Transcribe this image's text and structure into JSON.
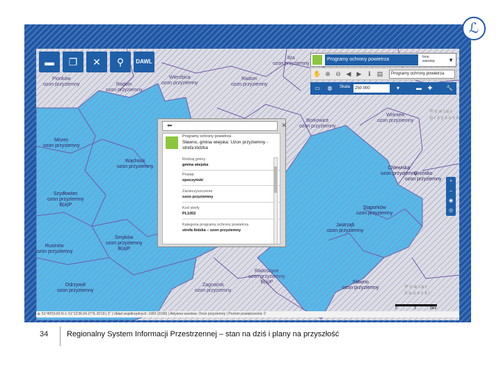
{
  "slide": {
    "number": "34",
    "footer_title": "Regionalny System Informacji Przestrzennej – stan na dziś i plany na przyszłość",
    "logo_glyph": "ℒ"
  },
  "colors": {
    "frame": "#1f57a6",
    "map_blue": "#55b9e9",
    "map_gray": "#dcdde4",
    "boundary": "#6f5aa8",
    "accent_green": "#8cc63e"
  },
  "toolbar": {
    "buttons": [
      {
        "name": "folder-icon",
        "glyph": "▬"
      },
      {
        "name": "windows-icon",
        "glyph": "❐"
      },
      {
        "name": "tools-icon",
        "glyph": "✕"
      },
      {
        "name": "search-icon",
        "glyph": "⚲"
      },
      {
        "name": "dawl-button",
        "glyph": "DAWL"
      }
    ]
  },
  "layer_select": {
    "value": "Programy ochrony powietrza",
    "sub": "Inne\nwarstwy",
    "arrow": "▼"
  },
  "toolbar2": {
    "select_value": "Programy ochrony powietrza"
  },
  "toolbar3": {
    "scale_label": "Skala",
    "scale_value": "250 000"
  },
  "side_ctrl": [
    "+",
    "–",
    "◉",
    "◎"
  ],
  "powiats": [
    {
      "text": "Powiat\nprzysucki"
    },
    {
      "text": "Powiat\nkonecki"
    }
  ],
  "regions": [
    {
      "text": "Pionków\nozon przyziemny"
    },
    {
      "text": "Radom\nozon przyziemny"
    },
    {
      "text": "Wierzbica\nozon przyziemny"
    },
    {
      "text": "Radom\nozon przyziemny"
    },
    {
      "text": "Iłża\nozon przyziemny"
    },
    {
      "text": "Wolanów\nozon przyziemny"
    },
    {
      "text": "Kowala\nozon przyziemny"
    },
    {
      "text": "Mirzec\nozon przyziemny"
    },
    {
      "text": "Wąchock\nozon przyziemny"
    },
    {
      "text": "Skaryszew\nozon przyziemny"
    },
    {
      "text": "Gowarczów\nozon przyziemny"
    },
    {
      "text": "Wieniawa\nozon przyziemny"
    },
    {
      "text": "Przysucha\nozon przyziemny"
    },
    {
      "text": "Wiśniew\nozon przyziemny"
    },
    {
      "text": "Borkowice\nozon przyziemny"
    },
    {
      "text": "Chlewiska\nozon przyziemny"
    },
    {
      "text": "Szydłowiec\nozon przyziemny\nB(a)P"
    },
    {
      "text": "Orońsko\nozon przyziemny"
    },
    {
      "text": "Stąporków\nozon przyziemny"
    },
    {
      "text": "Jastrząb\nozon przyziemny"
    },
    {
      "text": "Mirów\nozon przyziemny"
    },
    {
      "text": "Kazanów\nozon przyziemny"
    },
    {
      "text": "Bliżyn\nozon przyziemny"
    },
    {
      "text": "Końskie\nozon przyziemny"
    },
    {
      "text": "Smyków\nozon przyziemny\nB(a)P"
    },
    {
      "text": "Rusinów\nozon przyziemny"
    },
    {
      "text": "Ruda Maleniecka\nozon przyziemny"
    },
    {
      "text": "Sławno\nozon przyziemny"
    },
    {
      "text": "Odrzywół\nozon przyziemny"
    },
    {
      "text": "Radoszyce\nozon przyziemny\nB(a)P"
    },
    {
      "text": "Zagnańsk\nozon przyziemny"
    },
    {
      "text": "Potworów\nozon przyziemny"
    },
    {
      "text": "Ruda Maleniecka\nozon przyziemny"
    }
  ],
  "popup": {
    "type": "Programy ochrony powietrza",
    "title": "Sławno, gmina wiejska: Uzon przyziemny - strefa łódzka",
    "fields": [
      {
        "label": "Rodzaj gminy",
        "value": "gmina wiejska"
      },
      {
        "label": "Powiat",
        "value": "opoczyński"
      },
      {
        "label": "Zanieczyszczenie",
        "value": "ozon przyziemny"
      },
      {
        "label": "Kod strefy",
        "value": "PL1002"
      },
      {
        "label": "Kategoria programu ochrony powietrza",
        "value": "strefa łódzka – ozon przyziemny"
      }
    ]
  },
  "statusbar": {
    "text": "φ: 51°49'53.83 N  λ: 51°12'36.04 27°E 20'18 | 2\" | Układ współrzędnych: 1992 (2180) | Aktywna warstwa: Ozon przyziemny | Poziom powiększenia: 0"
  },
  "scalebar": {
    "left": "0",
    "mid": "3",
    "right": "6km"
  }
}
